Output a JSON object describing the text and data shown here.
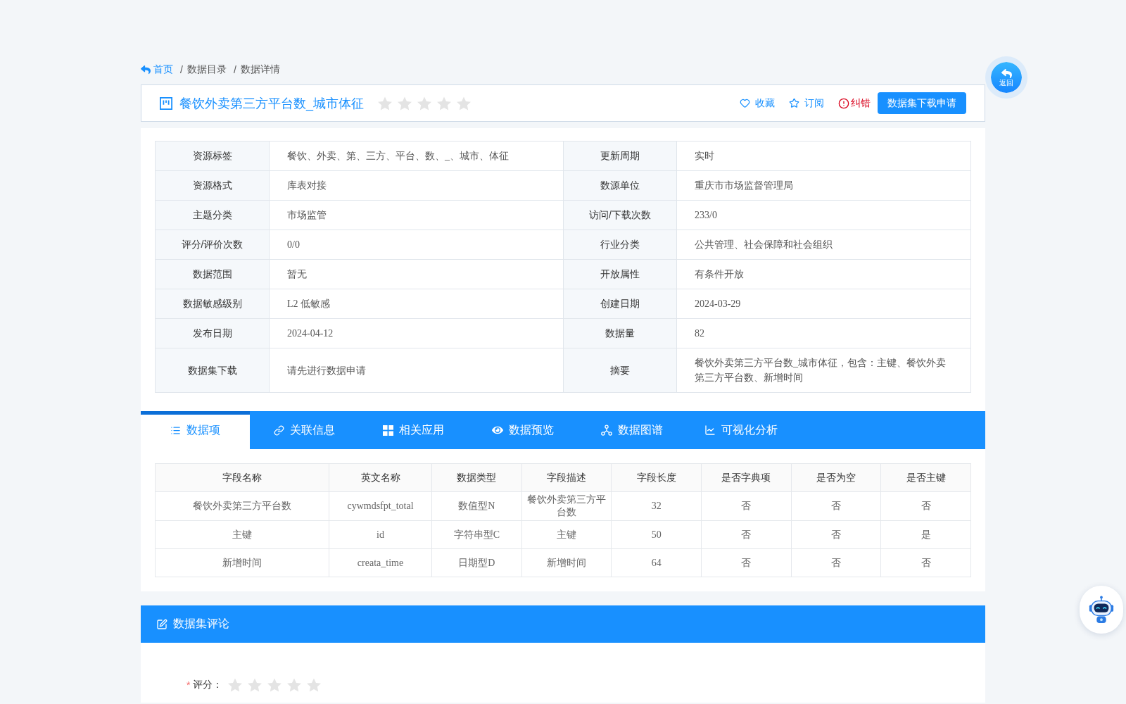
{
  "breadcrumb": {
    "separator": "/",
    "items": [
      {
        "label": "首页",
        "kind": "link"
      },
      {
        "label": "数据目录",
        "kind": "text"
      },
      {
        "label": "数据详情",
        "kind": "text"
      }
    ]
  },
  "back_button": {
    "label": "返回"
  },
  "title_bar": {
    "title": "餐饮外卖第三方平台数_城市体征",
    "stars": 0,
    "actions": [
      {
        "label": "收藏",
        "kind": "link"
      },
      {
        "label": "订阅",
        "kind": "link"
      },
      {
        "label": "纠错",
        "kind": "danger"
      },
      {
        "label": "数据集下载申请",
        "kind": "primary"
      }
    ]
  },
  "info": [
    {
      "label": "资源标签",
      "value": "餐饮、外卖、第、三方、平台、数、_、城市、体征"
    },
    {
      "label": "更新周期",
      "value": "实时"
    },
    {
      "label": "资源格式",
      "value": "库表对接"
    },
    {
      "label": "数源单位",
      "value": "重庆市市场监督管理局"
    },
    {
      "label": "主题分类",
      "value": "市场监管"
    },
    {
      "label": "访问/下载次数",
      "value": "233/0"
    },
    {
      "label": "评分/评价次数",
      "value": "0/0"
    },
    {
      "label": "行业分类",
      "value": "公共管理、社会保障和社会组织"
    },
    {
      "label": "数据范围",
      "value": "暂无"
    },
    {
      "label": "开放属性",
      "value": "有条件开放"
    },
    {
      "label": "数据敏感级别",
      "value": "L2 低敏感"
    },
    {
      "label": "创建日期",
      "value": "2024-03-29"
    },
    {
      "label": "发布日期",
      "value": "2024-04-12"
    },
    {
      "label": "数据量",
      "value": "82"
    },
    {
      "label": "数据集下载",
      "value": "请先进行数据申请"
    },
    {
      "label": "摘要",
      "value": "餐饮外卖第三方平台数_城市体征，包含：主键、餐饮外卖第三方平台数、新增时间"
    }
  ],
  "tabs": [
    {
      "label": "数据项",
      "selected": true
    },
    {
      "label": "关联信息",
      "selected": false
    },
    {
      "label": "相关应用",
      "selected": false
    },
    {
      "label": "数据预览",
      "selected": false
    },
    {
      "label": "数据图谱",
      "selected": false
    },
    {
      "label": "可视化分析",
      "selected": false
    }
  ],
  "fields_table": {
    "columns": [
      "字段名称",
      "英文名称",
      "数据类型",
      "字段描述",
      "字段长度",
      "是否字典项",
      "是否为空",
      "是否主键"
    ],
    "rows": [
      [
        "餐饮外卖第三方平台数",
        "cywmdsfpt_total",
        "数值型N",
        "餐饮外卖第三方平台数",
        "32",
        "否",
        "否",
        "否"
      ],
      [
        "主键",
        "id",
        "字符串型C",
        "主键",
        "50",
        "否",
        "否",
        "是"
      ],
      [
        "新增时间",
        "creata_time",
        "日期型D",
        "新增时间",
        "64",
        "否",
        "否",
        "否"
      ]
    ]
  },
  "comments": {
    "title": "数据集评论",
    "rating": {
      "required_mark": "*",
      "label": "评分：",
      "stars": 0
    }
  }
}
